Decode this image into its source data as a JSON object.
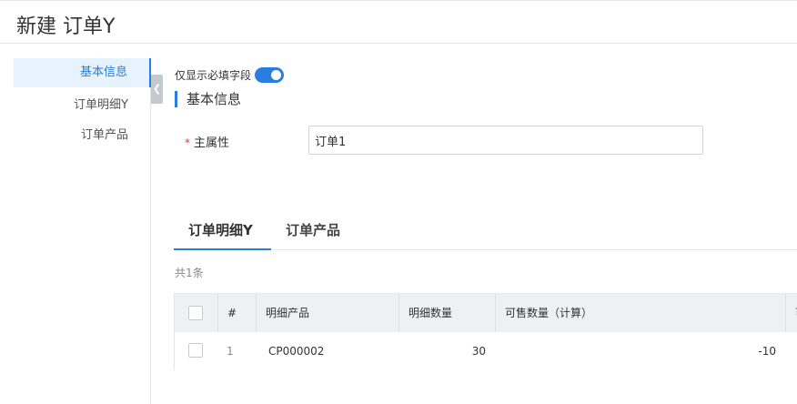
{
  "header": {
    "title": "新建 订单Y"
  },
  "sidebar": {
    "items": [
      {
        "label": "基本信息",
        "active": true
      },
      {
        "label": "订单明细Y",
        "active": false
      },
      {
        "label": "订单产品",
        "active": false
      }
    ],
    "collapse_icon": "chevron-left-icon"
  },
  "form": {
    "toggle_label": "仅显示必填字段",
    "toggle_on": true,
    "section_title": "基本信息",
    "fields": [
      {
        "label": "主属性",
        "required_mark": "*",
        "value": "订单1"
      }
    ]
  },
  "tabs": [
    {
      "label": "订单明细Y",
      "active": true
    },
    {
      "label": "订单产品",
      "active": false
    }
  ],
  "table": {
    "count_text": "共1条",
    "headers": [
      "#",
      "明细产品",
      "明细数量",
      "可售数量（计算）",
      "可"
    ],
    "rows": [
      {
        "index": "1",
        "product": "CP000002",
        "quantity": "30",
        "available": "-10"
      }
    ]
  },
  "colors": {
    "accent": "#2b7de0",
    "required": "#e53935",
    "active_nav_bg": "#e6f2fd"
  }
}
